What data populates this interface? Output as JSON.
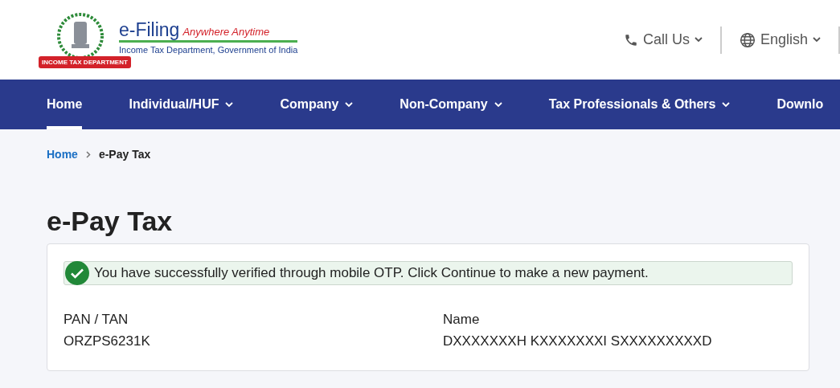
{
  "header": {
    "logo": {
      "ribbon": "INCOME TAX DEPARTMENT",
      "brand": "e-Filing",
      "tagline": "Anywhere Anytime",
      "subtitle": "Income Tax Department, Government of India"
    },
    "actions": [
      {
        "kind": "phone",
        "label": "Call Us"
      },
      {
        "kind": "globe",
        "label": "English"
      }
    ]
  },
  "nav": [
    {
      "label": "Home",
      "selected": true,
      "dropdown": false
    },
    {
      "label": "Individual/HUF",
      "selected": false,
      "dropdown": true
    },
    {
      "label": "Company",
      "selected": false,
      "dropdown": true
    },
    {
      "label": "Non-Company",
      "selected": false,
      "dropdown": true
    },
    {
      "label": "Tax Professionals & Others",
      "selected": false,
      "dropdown": true
    },
    {
      "label": "Downlo",
      "selected": false,
      "dropdown": false
    }
  ],
  "breadcrumb": [
    {
      "label": "Home",
      "link": true
    },
    {
      "label": "e-Pay Tax",
      "link": false
    }
  ],
  "page_title": "e-Pay Tax",
  "alert": {
    "kind": "success",
    "message": "You have successfully verified through mobile OTP. Click Continue to make a new payment."
  },
  "fields": [
    {
      "label": "PAN / TAN",
      "value": "ORZPS6231K"
    },
    {
      "label": "Name",
      "value": "DXXXXXXXH KXXXXXXXI SXXXXXXXXXD"
    }
  ]
}
